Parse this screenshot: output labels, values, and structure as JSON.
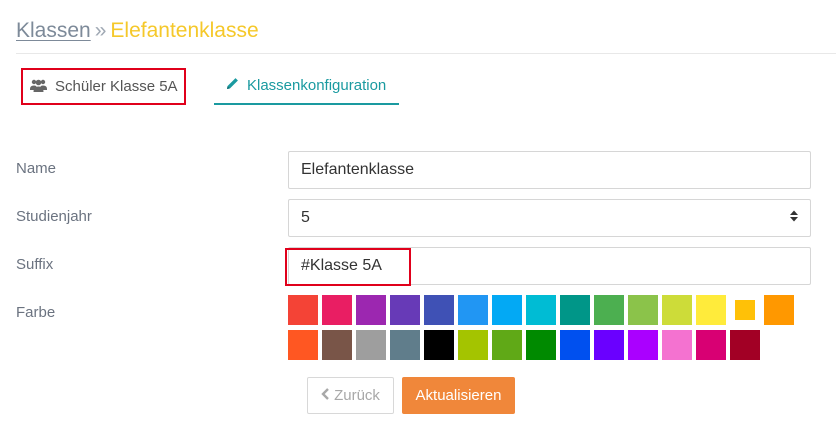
{
  "breadcrumb": {
    "parent": "Klassen",
    "separator": "»",
    "current": "Elefantenklasse"
  },
  "tabs": {
    "students": {
      "label": "Schüler Klasse 5A",
      "icon": "users-icon"
    },
    "config": {
      "label": "Klassenkonfiguration",
      "icon": "pencil-icon"
    }
  },
  "form": {
    "name": {
      "label": "Name",
      "value": "Elefantenklasse"
    },
    "year": {
      "label": "Studienjahr",
      "value": "5"
    },
    "suffix": {
      "label": "Suffix",
      "value": "#Klasse 5A"
    },
    "color": {
      "label": "Farbe"
    }
  },
  "colors": {
    "row1": [
      "#f44336",
      "#e91e63",
      "#9c27b0",
      "#673ab7",
      "#3f51b5",
      "#2196f3",
      "#03a9f4",
      "#00bcd4",
      "#009688",
      "#4caf50",
      "#8bc34a",
      "#cddc39",
      "#ffeb3b",
      "#ffc107",
      "#ff9800"
    ],
    "row2": [
      "#ff5722",
      "#795548",
      "#9e9e9e",
      "#607d8b",
      "#000000",
      "#a4c400",
      "#60a917",
      "#008a00",
      "#0050ef",
      "#6a00ff",
      "#aa00ff",
      "#f472d0",
      "#d80073",
      "#a20025"
    ],
    "selected": "#ffc107"
  },
  "buttons": {
    "back": "Zurück",
    "update": "Aktualisieren"
  }
}
